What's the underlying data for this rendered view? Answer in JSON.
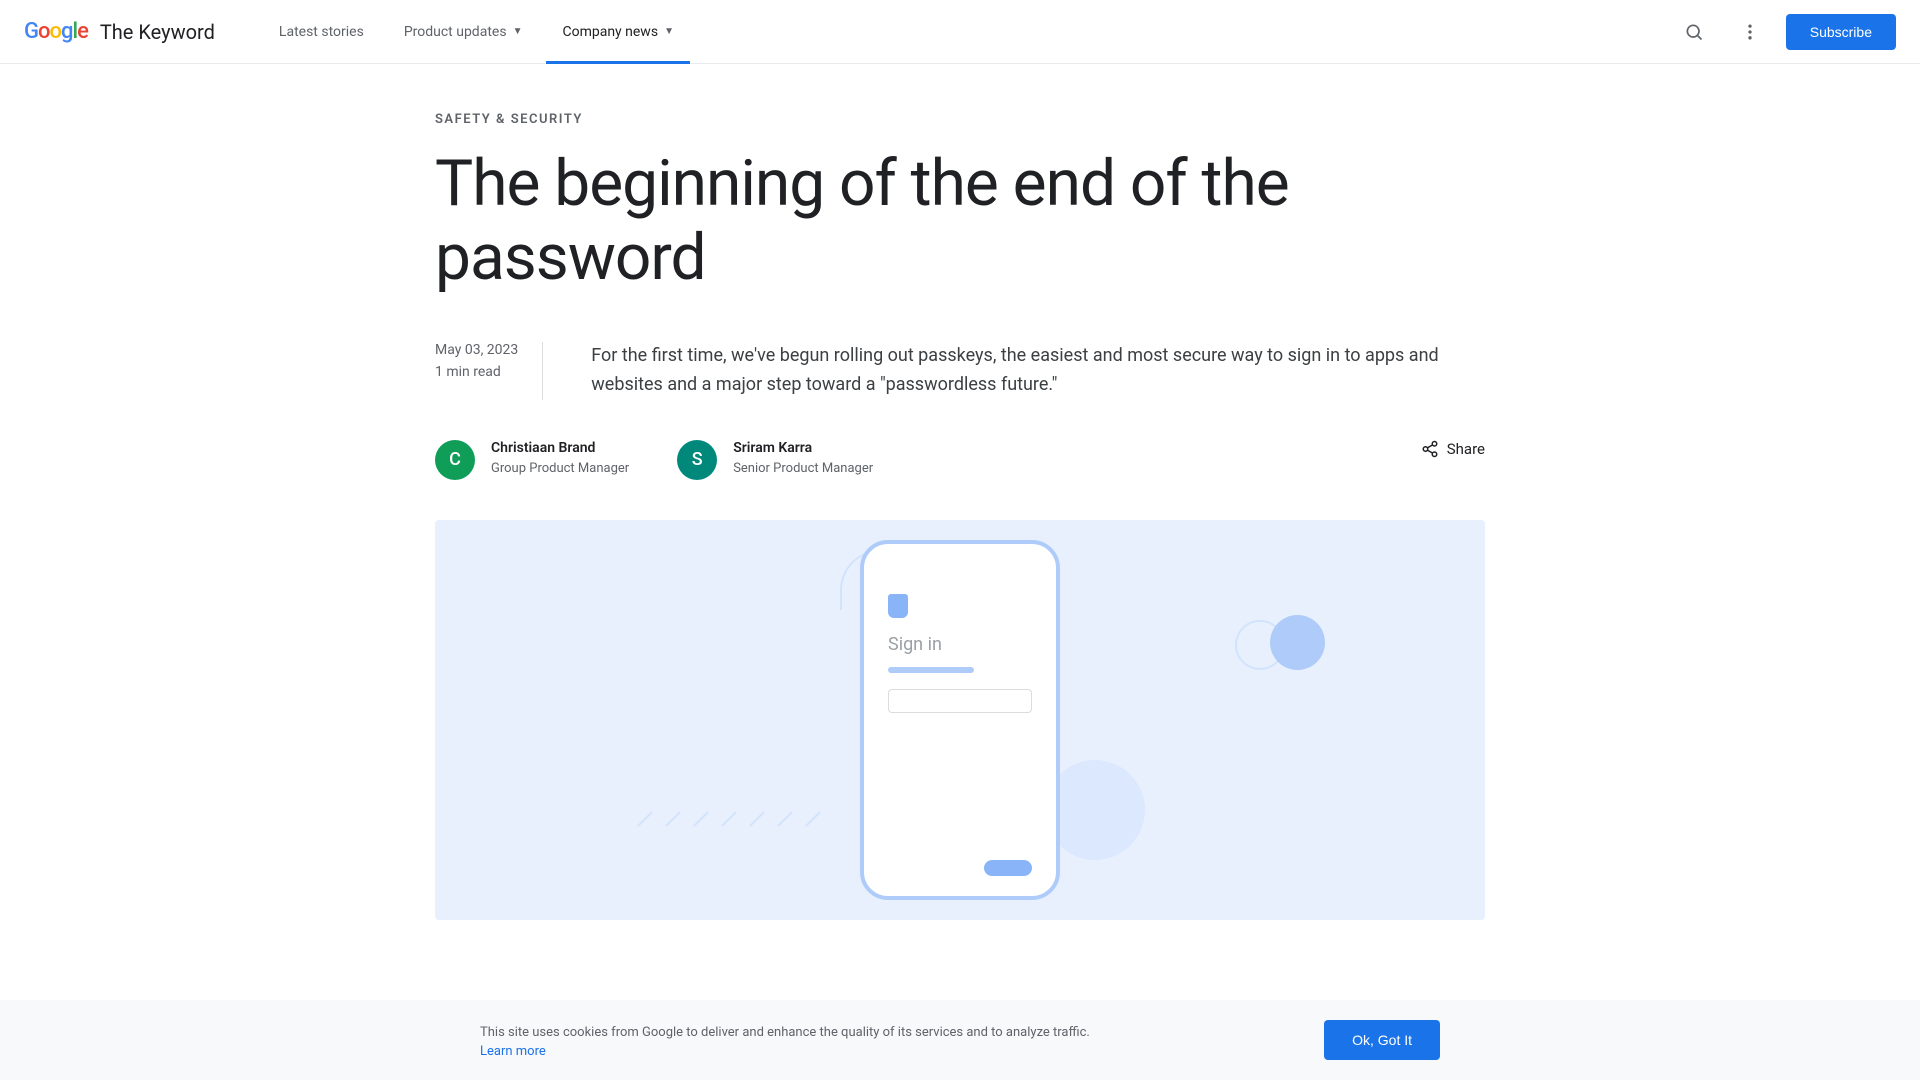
{
  "header": {
    "logo": "Google",
    "site_name": "The Keyword",
    "nav": [
      {
        "label": "Latest stories",
        "has_dropdown": false
      },
      {
        "label": "Product updates",
        "has_dropdown": true
      },
      {
        "label": "Company news",
        "has_dropdown": true,
        "active": true
      }
    ],
    "subscribe_label": "Subscribe"
  },
  "article": {
    "category": "SAFETY & SECURITY",
    "title": "The beginning of the end of the password",
    "date": "May 03, 2023",
    "read_time": "1 min read",
    "summary": "For the first time, we've begun rolling out passkeys, the easiest and most secure way to sign in to apps and websites and a major step toward a \"passwordless future.\"",
    "authors": [
      {
        "initial": "C",
        "name": "Christiaan Brand",
        "role": "Group Product Manager"
      },
      {
        "initial": "S",
        "name": "Sriram Karra",
        "role": "Senior Product Manager"
      }
    ],
    "share_label": "Share",
    "hero_signin_text": "Sign in"
  },
  "cookie": {
    "text": "This site uses cookies from Google to deliver and enhance the quality of its services and to analyze traffic.",
    "link": "Learn more",
    "button": "Ok, Got It"
  }
}
